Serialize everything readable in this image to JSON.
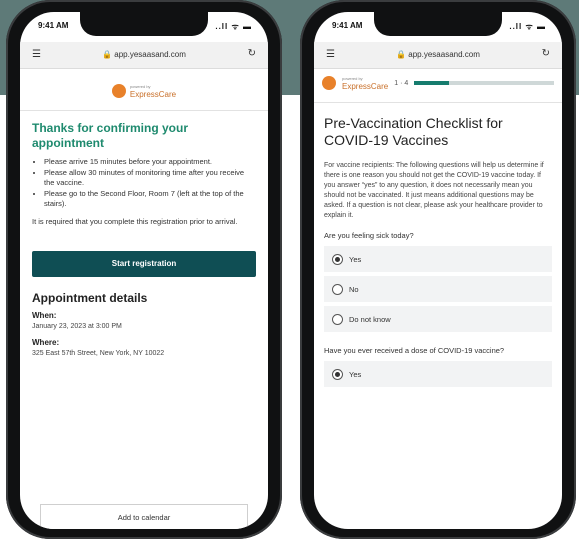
{
  "left": {
    "status_time": "9:41 AM",
    "status_signal": "..ll ᯤ ▬",
    "url": "🔒 app.yesaasand.com",
    "logo_brand": "ExpressCare",
    "logo_super": "powered by",
    "confirm_title": "Thanks for confirming your appointment",
    "bullets": [
      "Please arrive 15 minutes before your appointment.",
      "Please allow 30 minutes of monitoring time after you receive the vaccine.",
      "Please go to the Second Floor, Room 7 (left at the top of the stairs)."
    ],
    "note": "It is required that you complete this registration prior to arrival.",
    "start_label": "Start registration",
    "details_title": "Appointment details",
    "when_label": "When:",
    "when_value": "January 23, 2023 at 3:00 PM",
    "where_label": "Where:",
    "where_value": "325 East 57th Street, New York, NY 10022",
    "calendar_label": "Add to calendar"
  },
  "right": {
    "status_time": "9:41 AM",
    "status_signal": "..ll ᯤ ▬",
    "url": "🔒 app.yesaasand.com",
    "logo_brand": "ExpressCare",
    "logo_super": "powered by",
    "step_text": "1 · 4",
    "progress": 0.25,
    "title": "Pre-Vaccination Checklist for COVID-19 Vaccines",
    "intro": "For vaccine recipients: The following questions will help us determine if there is one reason you should not get the COVID-19 vaccine today. If you answer “yes” to any question, it does not necessarily mean you should not be vaccinated. It just means additional questions may be asked. If a question is not clear, please ask your healthcare provider to explain it.",
    "q1": "Are you feeling sick today?",
    "q1_options": [
      "Yes",
      "No",
      "Do not know"
    ],
    "q2": "Have you ever received a dose of COVID-19 vaccine?",
    "q2_option": "Yes"
  },
  "colors": {
    "accent_teal": "#0f4e54",
    "success_green": "#1e8a6e",
    "brand_orange": "#e8812a",
    "background_band": "#5e7a78"
  }
}
